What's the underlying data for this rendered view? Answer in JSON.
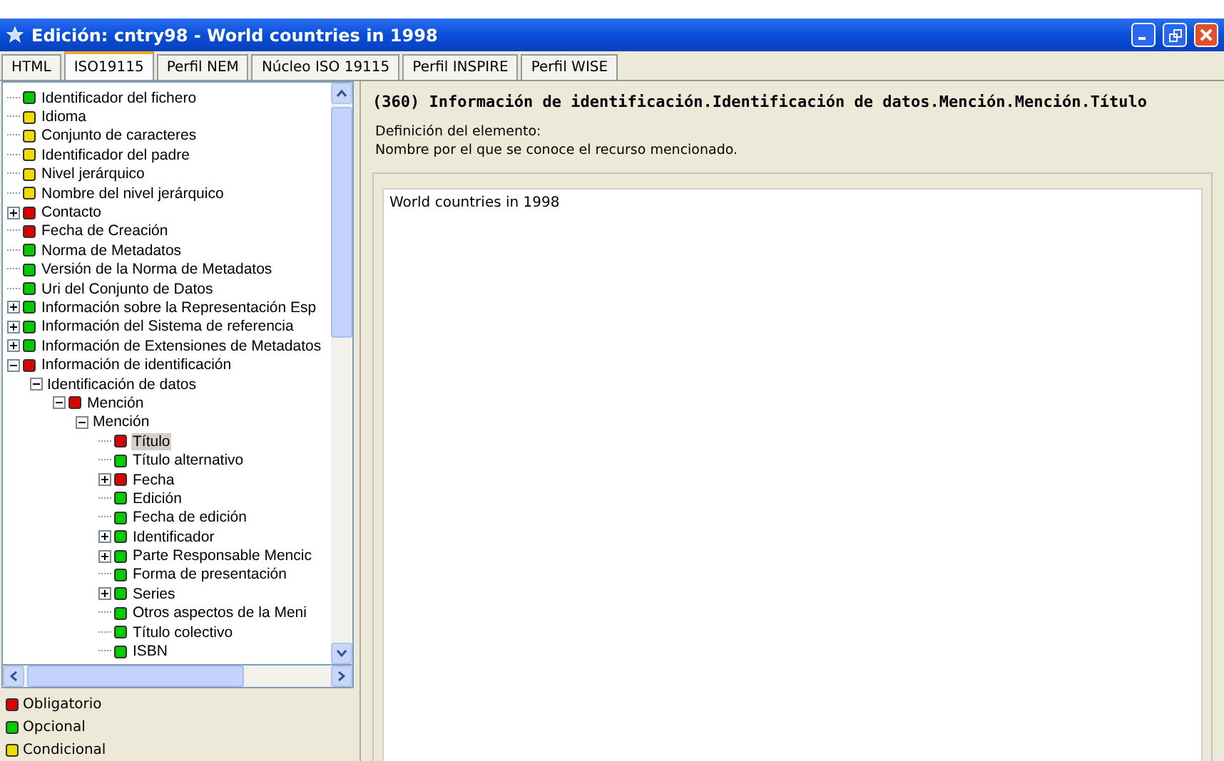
{
  "window": {
    "title": "Edición: cntry98 - World countries in 1998"
  },
  "tabs": [
    {
      "label": "HTML",
      "selected": false
    },
    {
      "label": "ISO19115",
      "selected": true
    },
    {
      "label": "Perfil NEM",
      "selected": false
    },
    {
      "label": "Núcleo ISO 19115",
      "selected": false
    },
    {
      "label": "Perfil INSPIRE",
      "selected": false
    },
    {
      "label": "Perfil WISE",
      "selected": false
    }
  ],
  "tree": [
    {
      "label": "Identificador del fichero",
      "color": "#00cc00",
      "selected": false
    },
    {
      "label": "Idioma",
      "color": "#eedd00",
      "selected": false
    },
    {
      "label": "Conjunto de caracteres",
      "color": "#eedd00",
      "selected": false
    },
    {
      "label": "Identificador del padre",
      "color": "#eedd00",
      "selected": false
    },
    {
      "label": "Nivel jerárquico",
      "color": "#eedd00",
      "selected": false
    },
    {
      "label": "Nombre del nivel jerárquico",
      "color": "#eedd00",
      "selected": false
    },
    {
      "label": "Contacto",
      "color": "#dd0000",
      "selected": false,
      "expanded": false
    },
    {
      "label": "Fecha de Creación",
      "color": "#dd0000",
      "selected": false
    },
    {
      "label": "Norma de Metadatos",
      "color": "#00cc00",
      "selected": false
    },
    {
      "label": "Versión de la Norma de Metadatos",
      "color": "#00cc00",
      "selected": false
    },
    {
      "label": "Uri del Conjunto de Datos",
      "color": "#00cc00",
      "selected": false
    },
    {
      "label": "Información sobre la Representación Esp",
      "color": "#00cc00",
      "selected": false,
      "expanded": false
    },
    {
      "label": "Información del Sistema de referencia",
      "color": "#00cc00",
      "selected": false,
      "expanded": false
    },
    {
      "label": "Información de Extensiones de Metadatos",
      "color": "#00cc00",
      "selected": false,
      "expanded": false
    },
    {
      "label": "Información de identificación",
      "color": "#dd0000",
      "selected": false,
      "expanded": true,
      "children": [
        {
          "label": "Identificación de datos",
          "selected": false,
          "expanded": true,
          "children": [
            {
              "label": "Mención",
              "color": "#dd0000",
              "selected": false,
              "expanded": true,
              "children": [
                {
                  "label": "Mención",
                  "selected": false,
                  "expanded": true,
                  "children": [
                    {
                      "label": "Título",
                      "color": "#dd0000",
                      "selected": true
                    },
                    {
                      "label": "Título alternativo",
                      "color": "#00cc00",
                      "selected": false
                    },
                    {
                      "label": "Fecha",
                      "color": "#dd0000",
                      "selected": false,
                      "expanded": false
                    },
                    {
                      "label": "Edición",
                      "color": "#00cc00",
                      "selected": false
                    },
                    {
                      "label": "Fecha de edición",
                      "color": "#00cc00",
                      "selected": false
                    },
                    {
                      "label": "Identificador",
                      "color": "#00cc00",
                      "selected": false,
                      "expanded": false
                    },
                    {
                      "label": "Parte Responsable Mencic",
                      "color": "#00cc00",
                      "selected": false,
                      "expanded": false
                    },
                    {
                      "label": "Forma de presentación",
                      "color": "#00cc00",
                      "selected": false
                    },
                    {
                      "label": "Series",
                      "color": "#00cc00",
                      "selected": false,
                      "expanded": false
                    },
                    {
                      "label": "Otros aspectos de la Meni",
                      "color": "#00cc00",
                      "selected": false
                    },
                    {
                      "label": "Título colectivo",
                      "color": "#00cc00",
                      "selected": false
                    },
                    {
                      "label": "ISBN",
                      "color": "#00cc00",
                      "selected": false
                    }
                  ]
                }
              ]
            }
          ]
        }
      ]
    }
  ],
  "legend": [
    {
      "label": "Obligatorio",
      "color": "#dd0000"
    },
    {
      "label": "Opcional",
      "color": "#00cc00"
    },
    {
      "label": "Condicional",
      "color": "#eedd00"
    }
  ],
  "detail": {
    "heading": "(360) Información de identificación.Identificación de datos.Mención.Mención.Título",
    "definition_label": "Definición del elemento:",
    "definition": "Nombre por el que se conoce el recurso mencionado.",
    "value": "World countries in 1998"
  }
}
